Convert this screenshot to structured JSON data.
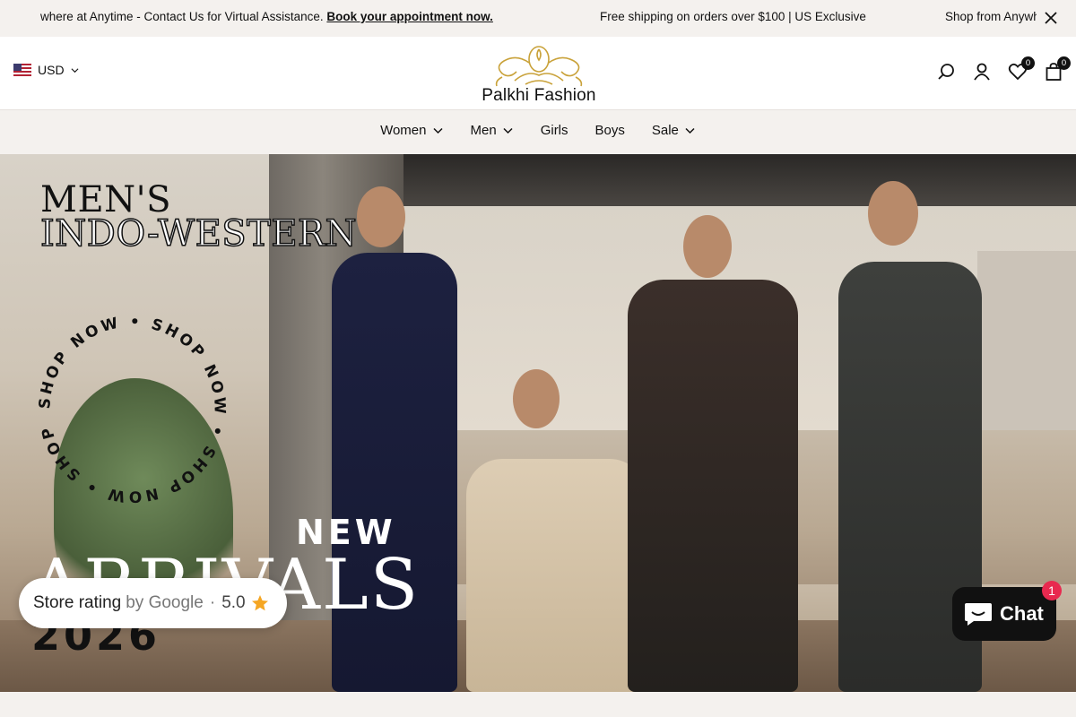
{
  "announcement": {
    "message_1_prefix": "where at Anytime - Contact Us for Virtual Assistance.",
    "message_1_link": "Book your appointment now.",
    "message_2": "Free shipping on orders over $100 | US Exclusive",
    "message_3": "Shop from Anywhere at Anytime"
  },
  "header": {
    "currency": "USD",
    "logo_text": "Palkhi Fashion",
    "wishlist_count": "0",
    "cart_count": "0"
  },
  "nav": {
    "items": [
      {
        "label": "Women",
        "has_dropdown": true
      },
      {
        "label": "Men",
        "has_dropdown": true
      },
      {
        "label": "Girls",
        "has_dropdown": false
      },
      {
        "label": "Boys",
        "has_dropdown": false
      },
      {
        "label": "Sale",
        "has_dropdown": true
      }
    ]
  },
  "hero": {
    "title_line_1": "MEN'S",
    "title_line_2": "INDO-WESTERN",
    "circular_text": "SHOP NOW • SHOP NOW • SHOP NOW • SHOP NOW •",
    "new_label": "NEW",
    "arrivals_label": "ARRIVALS",
    "year_label": "2026"
  },
  "store_rating": {
    "label": "Store rating",
    "source": "by Google",
    "separator": "·",
    "score": "5.0"
  },
  "chat": {
    "label": "Chat",
    "badge": "1"
  },
  "colors": {
    "announcement_bg": "#f4f1ee",
    "logo_gold": "#c9a23a",
    "badge_dark": "#111111",
    "chat_badge": "#e8294f",
    "star": "#f5a623"
  },
  "icons": [
    "us-flag-icon",
    "chevron-down-icon",
    "search-icon",
    "account-icon",
    "heart-icon",
    "bag-icon",
    "close-icon",
    "star-icon",
    "chat-bubble-icon"
  ]
}
